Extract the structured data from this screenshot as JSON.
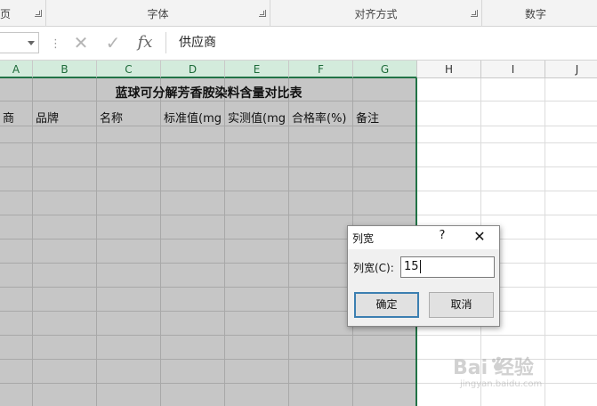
{
  "ribbon": {
    "groups": [
      {
        "label": "页"
      },
      {
        "label": "字体"
      },
      {
        "label": "对齐方式"
      },
      {
        "label": "数字"
      }
    ]
  },
  "formula_bar": {
    "name_box": "",
    "separator": "⋮",
    "cancel_icon": "✕",
    "enter_icon": "✓",
    "fx_label": "fx",
    "content": "供应商"
  },
  "columns": [
    "A",
    "B",
    "C",
    "D",
    "E",
    "F",
    "G",
    "H",
    "I",
    "J"
  ],
  "sheet": {
    "title": "蓝球可分解芳香胺染料含量对比表",
    "header_row": [
      "商",
      "品牌",
      "名称",
      "标准值(mg",
      "实测值(mg",
      "合格率(%)",
      "备注"
    ]
  },
  "dialog": {
    "title": "列宽",
    "help": "?",
    "close": "✕",
    "field_label": "列宽(C):",
    "field_value": "15",
    "ok_label": "确定",
    "cancel_label": "取消"
  },
  "watermark": {
    "logo": "Bai  经验",
    "url": "jingyan.baidu.com"
  },
  "colors": {
    "selection_fill": "#c6c6c6",
    "selection_accent": "#217346",
    "header_selected": "#d3ebdc"
  }
}
